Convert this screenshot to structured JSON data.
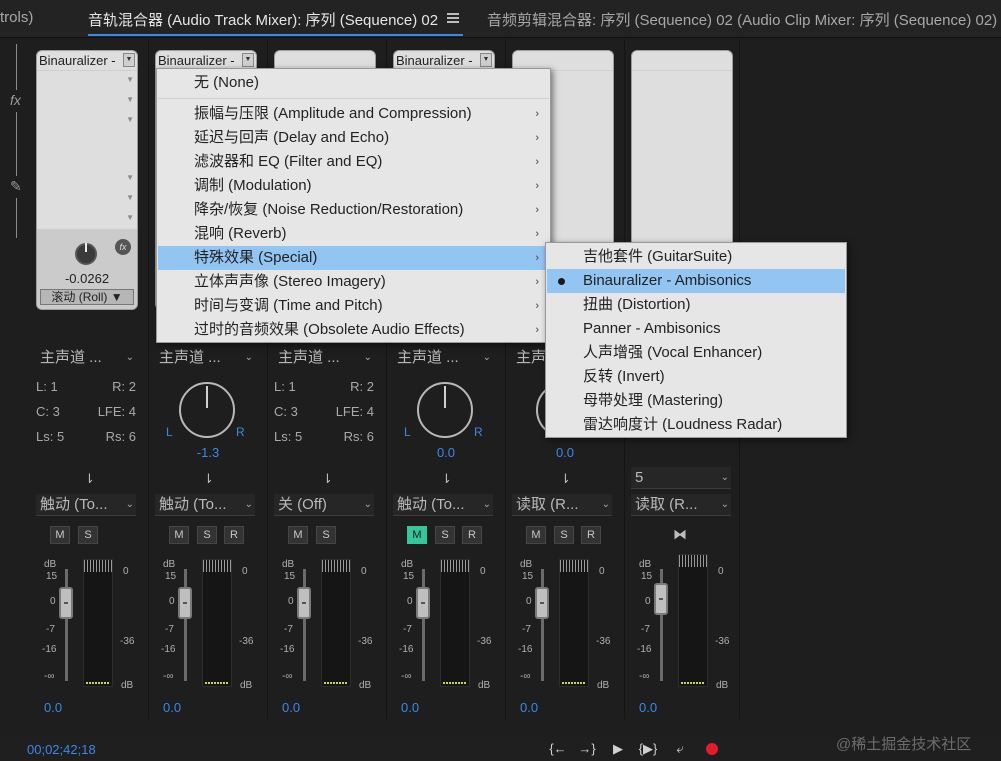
{
  "tabs": {
    "left_partial": "trols)",
    "active": "音轨混合器 (Audio Track Mixer): 序列 (Sequence) 02",
    "second": "音频剪辑混合器: 序列 (Sequence) 02 (Audio Clip Mixer: 序列 (Sequence) 02)"
  },
  "left_rail": {
    "fx_label": "fx",
    "send_label": "✎"
  },
  "tracks": [
    {
      "fx_slot": "Binauralizer -",
      "knob_value": "-0.0262",
      "roll": "滚动 (Roll)",
      "output": "主声道 ...",
      "map": [
        "L: 1",
        "R: 2",
        "C: 3",
        "LFE: 4",
        "Ls: 5",
        "Rs: 6"
      ],
      "auto": "触动 (To...",
      "vol": "0.0"
    },
    {
      "fx_slot": "Binauralizer -",
      "output": "主声道 ...",
      "pan": "-1.3",
      "auto": "触动 (To...",
      "vol": "0.0"
    },
    {
      "output": "主声道 ...",
      "map": [
        "L: 1",
        "R: 2",
        "C: 3",
        "LFE: 4",
        "Ls: 5",
        "Rs: 6"
      ],
      "auto": "关 (Off)",
      "vol": "0.0"
    },
    {
      "fx_slot": "Binauralizer -",
      "output": "主声道 ...",
      "pan": "0.0",
      "auto": "触动 (To...",
      "vol": "0.0"
    },
    {
      "output": "主声道 ...",
      "pan": "0.0",
      "auto": "读取 (R...",
      "vol": "0.0"
    },
    {
      "output": "5",
      "auto": "读取 (R...",
      "vol": "0.0"
    }
  ],
  "buttons": {
    "mute": "M",
    "solo": "S",
    "record": "R"
  },
  "meter_scale": {
    "db": "dB",
    "plus15": "15",
    "zero": "0",
    "minus7": "-7",
    "minus16": "-16",
    "minusinf": "-∞",
    "right_zero": "0",
    "right_36": "-36",
    "right_db": "dB"
  },
  "pan_labels": {
    "L": "L",
    "R": "R"
  },
  "timecode": "00;02;42;18",
  "transport": {
    "to_in": "{←",
    "to_out": "→}",
    "play": "▶",
    "loop": "{▶}",
    "loop_icon": "⤶"
  },
  "watermark": "@稀土掘金技术社区",
  "effects_menu": {
    "none": "无 (None)",
    "items": [
      "振幅与压限 (Amplitude and Compression)",
      "延迟与回声 (Delay and Echo)",
      "滤波器和 EQ (Filter and EQ)",
      "调制 (Modulation)",
      "降杂/恢复 (Noise Reduction/Restoration)",
      "混响 (Reverb)",
      "特殊效果 (Special)",
      "立体声声像 (Stereo Imagery)",
      "时间与变调 (Time and Pitch)",
      "过时的音频效果 (Obsolete Audio Effects)"
    ],
    "highlighted_index": 6
  },
  "special_submenu": {
    "items": [
      "吉他套件 (GuitarSuite)",
      "Binauralizer - Ambisonics",
      "扭曲 (Distortion)",
      "Panner - Ambisonics",
      "人声增强 (Vocal Enhancer)",
      "反转 (Invert)",
      "母带处理 (Mastering)",
      "雷达响度计 (Loudness Radar)"
    ],
    "selected_index": 1
  },
  "colors": {
    "accent": "#3a88e8",
    "menu_highlight": "#93c5f3",
    "mute_on": "#35c79b",
    "record": "#e21b2e"
  }
}
